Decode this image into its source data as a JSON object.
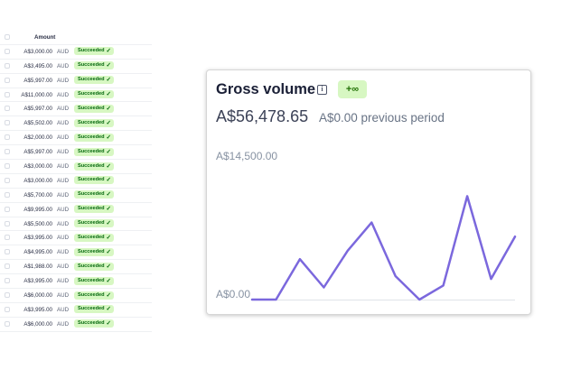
{
  "payments_table": {
    "header": {
      "amount": "Amount"
    },
    "rows": [
      {
        "amount": "A$3,000.00",
        "currency": "AUD",
        "status": "Succeeded"
      },
      {
        "amount": "A$3,495.00",
        "currency": "AUD",
        "status": "Succeeded"
      },
      {
        "amount": "A$5,997.00",
        "currency": "AUD",
        "status": "Succeeded"
      },
      {
        "amount": "A$11,000.00",
        "currency": "AUD",
        "status": "Succeeded"
      },
      {
        "amount": "A$5,997.00",
        "currency": "AUD",
        "status": "Succeeded"
      },
      {
        "amount": "A$5,502.00",
        "currency": "AUD",
        "status": "Succeeded"
      },
      {
        "amount": "A$2,000.00",
        "currency": "AUD",
        "status": "Succeeded"
      },
      {
        "amount": "A$5,997.00",
        "currency": "AUD",
        "status": "Succeeded"
      },
      {
        "amount": "A$3,000.00",
        "currency": "AUD",
        "status": "Succeeded"
      },
      {
        "amount": "A$3,000.00",
        "currency": "AUD",
        "status": "Succeeded"
      },
      {
        "amount": "A$5,700.00",
        "currency": "AUD",
        "status": "Succeeded"
      },
      {
        "amount": "A$9,995.00",
        "currency": "AUD",
        "status": "Succeeded"
      },
      {
        "amount": "A$5,500.00",
        "currency": "AUD",
        "status": "Succeeded"
      },
      {
        "amount": "A$3,995.00",
        "currency": "AUD",
        "status": "Succeeded"
      },
      {
        "amount": "A$4,995.00",
        "currency": "AUD",
        "status": "Succeeded"
      },
      {
        "amount": "A$1,988.00",
        "currency": "AUD",
        "status": "Succeeded"
      },
      {
        "amount": "A$3,995.00",
        "currency": "AUD",
        "status": "Succeeded"
      },
      {
        "amount": "A$6,000.00",
        "currency": "AUD",
        "status": "Succeeded"
      },
      {
        "amount": "A$3,995.00",
        "currency": "AUD",
        "status": "Succeeded"
      },
      {
        "amount": "A$6,000.00",
        "currency": "AUD",
        "status": "Succeeded"
      }
    ],
    "status_color": "#d7f7c2",
    "status_text_color": "#05690d",
    "status_icon": "check-icon"
  },
  "gross_volume": {
    "title": "Gross volume",
    "info_icon": "info-icon",
    "delta_label": "+∞",
    "total": "A$56,478.65",
    "previous_period": "A$0.00 previous period",
    "line_color": "#7b68dd"
  },
  "chart_data": {
    "type": "line",
    "series": [
      {
        "values": [
          0,
          0,
          4300,
          1300,
          5200,
          8200,
          2500,
          0,
          1500,
          11000,
          2200,
          6700
        ]
      }
    ],
    "yticks": [
      "A$14,500.00",
      "A$0.00"
    ],
    "ylim": [
      0,
      14500
    ],
    "grid": false
  }
}
